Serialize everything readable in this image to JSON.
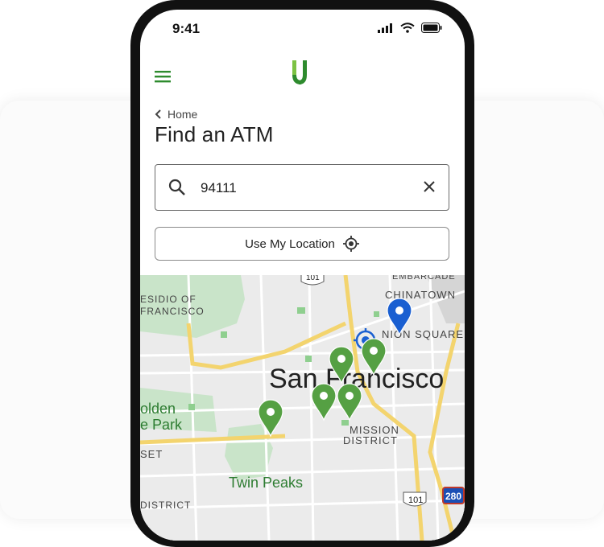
{
  "status": {
    "time": "9:41"
  },
  "header": {
    "menu_icon": "hamburger-icon",
    "logo": "u-logo"
  },
  "breadcrumb": {
    "label": "Home"
  },
  "page": {
    "title": "Find an ATM"
  },
  "search": {
    "value": "94111",
    "placeholder": ""
  },
  "location_button": {
    "label": "Use My Location"
  },
  "map": {
    "labels": {
      "embarcadero": "EMBARCADE",
      "chinatown": "CHINATOWN",
      "presidio_1": "ESIDIO OF",
      "presidio_2": "FRANCISCO",
      "union_square": "NION SQUARE",
      "city": "San Francisco",
      "golden_1": "olden",
      "golden_2": "e Park",
      "mission_1": "MISSION",
      "mission_2": "DISTRICT",
      "sunset": "SET",
      "twin_peaks": "Twin Peaks",
      "district": "DISTRICT",
      "hwy_101_top": "101",
      "hwy_101_bottom": "101",
      "hwy_280": "280"
    }
  },
  "colors": {
    "brand_green": "#2e8b2e",
    "pin_green": "#55a043",
    "pin_blue": "#1a5fd1"
  }
}
